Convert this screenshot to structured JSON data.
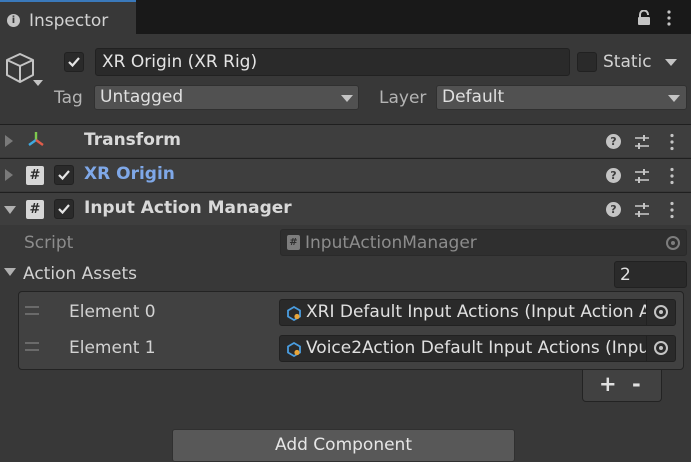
{
  "tab": {
    "title": "Inspector",
    "icon": "info-icon"
  },
  "header": {
    "active": true,
    "name": "XR Origin (XR Rig)",
    "static_label": "Static",
    "static_checked": false,
    "tag_label": "Tag",
    "tag_value": "Untagged",
    "layer_label": "Layer",
    "layer_value": "Default"
  },
  "components": [
    {
      "title": "Transform",
      "icon": "transform-icon",
      "expanded": false
    },
    {
      "title": "XR Origin",
      "icon": "script-icon",
      "enabled": true,
      "expanded": false,
      "title_color": "#7fa8e8"
    },
    {
      "title": "Input Action Manager",
      "icon": "script-icon",
      "enabled": true,
      "expanded": true
    }
  ],
  "input_action_manager": {
    "script_label": "Script",
    "script_value": "InputActionManager",
    "action_assets_label": "Action Assets",
    "action_assets_size": "2",
    "elements": [
      {
        "label": "Element 0",
        "value": "XRI Default Input Actions (Input Action A"
      },
      {
        "label": "Element 1",
        "value": "Voice2Action Default Input Actions (Inpu"
      }
    ],
    "add_symbol": "+",
    "remove_symbol": "-"
  },
  "add_component_label": "Add Component",
  "colors": {
    "accent": "#3a79bb",
    "background": "#383838",
    "link_title": "#7fa8e8"
  }
}
